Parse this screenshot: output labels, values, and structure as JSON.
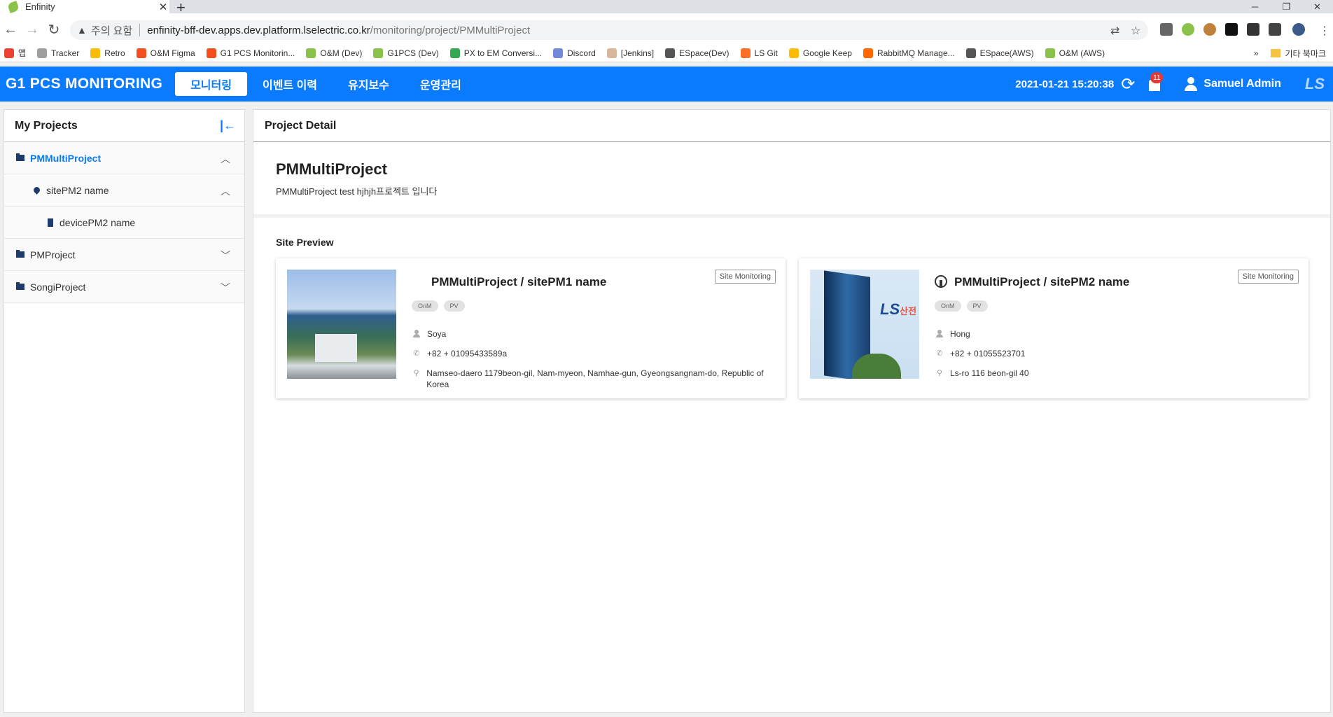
{
  "browser": {
    "tab_title": "Enfinity",
    "tab_close": "✕",
    "new_tab": "+",
    "security_warning": "주의 요함",
    "url_host": "enfinity-bff-dev.apps.dev.platform.lselectric.co.kr",
    "url_path": "/monitoring/project/PMMultiProject",
    "bookmarks": [
      {
        "label": "앱",
        "color": "#ea4335"
      },
      {
        "label": "Tracker",
        "color": "#9e9e9e"
      },
      {
        "label": "Retro",
        "color": "#fbbc05"
      },
      {
        "label": "O&M Figma",
        "color": "#f24e1e"
      },
      {
        "label": "G1 PCS Monitorin...",
        "color": "#f24e1e"
      },
      {
        "label": "O&M (Dev)",
        "color": "#8bc34a"
      },
      {
        "label": "G1PCS (Dev)",
        "color": "#8bc34a"
      },
      {
        "label": "PX to EM Conversi...",
        "color": "#34a853"
      },
      {
        "label": "Discord",
        "color": "#7289da"
      },
      {
        "label": "[Jenkins]",
        "color": "#d7b89b"
      },
      {
        "label": "ESpace(Dev)",
        "color": "#555555"
      },
      {
        "label": "LS Git",
        "color": "#fc6d26"
      },
      {
        "label": "Google Keep",
        "color": "#fbbc05"
      },
      {
        "label": "RabbitMQ Manage...",
        "color": "#ff6600"
      },
      {
        "label": "ESpace(AWS)",
        "color": "#555555"
      },
      {
        "label": "O&M (AWS)",
        "color": "#8bc34a"
      }
    ],
    "bookmarks_more": "»",
    "other_bookmarks": "기타 북마크"
  },
  "header": {
    "brand": "G1 PCS MONITORING",
    "menu": [
      {
        "label": "모니터링",
        "active": true
      },
      {
        "label": "이벤트 이력",
        "active": false
      },
      {
        "label": "유지보수",
        "active": false
      },
      {
        "label": "운영관리",
        "active": false
      }
    ],
    "datetime": "2021-01-21 15:20:38",
    "notification_count": "11",
    "user_name": "Samuel Admin",
    "logo": "LS"
  },
  "sidebar": {
    "title": "My Projects",
    "tree": [
      {
        "label": "PMMultiProject",
        "level": 0,
        "type": "project",
        "selected": true,
        "expanded": true
      },
      {
        "label": "sitePM2 name",
        "level": 1,
        "type": "site",
        "selected": false,
        "expanded": true
      },
      {
        "label": "devicePM2 name",
        "level": 2,
        "type": "device",
        "selected": false
      },
      {
        "label": "PMProject",
        "level": 0,
        "type": "project",
        "selected": false,
        "expanded": false
      },
      {
        "label": "SongiProject",
        "level": 0,
        "type": "project",
        "selected": false,
        "expanded": false
      }
    ]
  },
  "main": {
    "title": "Project Detail",
    "project_name": "PMMultiProject",
    "project_desc": "PMMultiProject test hjhjh프로젝트 입니다",
    "site_preview_title": "Site Preview",
    "sites": [
      {
        "title": "PMMultiProject / sitePM1 name",
        "button": "Site Monitoring",
        "tags": [
          "OnM",
          "PV"
        ],
        "person": "Soya",
        "phone": "+82 + 01095433589a",
        "address": "Namseo-daero 1179beon-gil, Nam-myeon, Namhae-gun, Gyeongsangnam-do, Republic of Korea",
        "has_status_icon": false
      },
      {
        "title": "PMMultiProject / sitePM2 name",
        "button": "Site Monitoring",
        "tags": [
          "OnM",
          "PV"
        ],
        "person": "Hong",
        "phone": "+82 + 01055523701",
        "address": "Ls-ro 116 beon-gil 40",
        "has_status_icon": true
      }
    ]
  }
}
